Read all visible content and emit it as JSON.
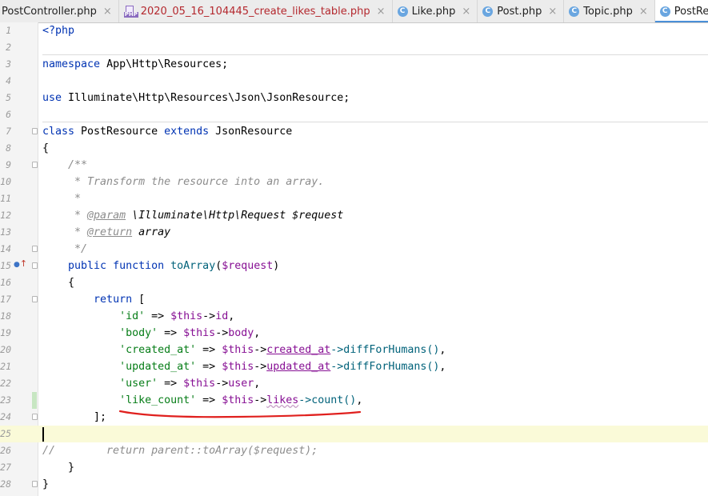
{
  "tabs": [
    {
      "label": "PostController.php",
      "icon": "none",
      "active": false
    },
    {
      "label": "2020_05_16_104445_create_likes_table.php",
      "icon": "php-file-icon",
      "active": false
    },
    {
      "label": "Like.php",
      "icon": "class-icon",
      "active": false
    },
    {
      "label": "Post.php",
      "icon": "class-icon",
      "active": false
    },
    {
      "label": "Topic.php",
      "icon": "class-icon",
      "active": false
    },
    {
      "label": "PostResource.php",
      "icon": "class-icon",
      "active": true
    }
  ],
  "close_glyph": "×",
  "class_icon_letter": "C",
  "php_icon_label": "PHP",
  "line_numbers": [
    "1",
    "2",
    "3",
    "4",
    "5",
    "6",
    "7",
    "8",
    "9",
    "10",
    "11",
    "12",
    "13",
    "14",
    "15",
    "16",
    "17",
    "18",
    "19",
    "20",
    "21",
    "22",
    "23",
    "24",
    "25",
    "26",
    "27",
    "28"
  ],
  "colors": {
    "keyword": "#0033b3",
    "string": "#067d17",
    "variable": "#871094",
    "comment": "#8c8c8c",
    "current_line": "#fafad8",
    "annotation_underline": "#e0201e",
    "active_tab_accent": "#4a8fd8"
  },
  "code": {
    "l1": "<?php",
    "l3_ns_kw": "namespace",
    "l3_ns": " App\\Http\\Resources;",
    "l5_use_kw": "use",
    "l5_use": " Illuminate\\Http\\Resources\\Json\\JsonResource;",
    "l7_class": "class",
    "l7_name": " PostResource ",
    "l7_extends": "extends",
    "l7_parent": " JsonResource",
    "l8": "{",
    "l9": "    /**",
    "l10": "     * Transform the resource into an array.",
    "l11": "     *",
    "l12_a": "     * ",
    "l12_tag": "@param",
    "l12_b": " \\Illuminate\\Http\\Request $request",
    "l13_a": "     * ",
    "l13_tag": "@return",
    "l13_b": " array",
    "l14": "     */",
    "l15_public": "public",
    "l15_function": "function",
    "l15_name": "toArray",
    "l15_param": "$request",
    "l16": "    {",
    "l17_return": "return",
    "l17_rest": " [",
    "rows": [
      {
        "key": "'id'",
        "arrow": " => ",
        "this": "$this",
        "access": "->",
        "prop": "id",
        "tail": ","
      },
      {
        "key": "'body'",
        "arrow": " => ",
        "this": "$this",
        "access": "->",
        "prop": "body",
        "tail": ","
      },
      {
        "key": "'created_at'",
        "arrow": " => ",
        "this": "$this",
        "access": "->",
        "prop": "created_at",
        "call": "->diffForHumans()",
        "tail": ","
      },
      {
        "key": "'updated_at'",
        "arrow": " => ",
        "this": "$this",
        "access": "->",
        "prop": "updated_at",
        "call": "->diffForHumans()",
        "tail": ","
      },
      {
        "key": "'user'",
        "arrow": " => ",
        "this": "$this",
        "access": "->",
        "prop": "user",
        "tail": ","
      },
      {
        "key": "'like_count'",
        "arrow": " => ",
        "this": "$this",
        "access": "->",
        "prop": "likes",
        "call": "->count()",
        "tail": ","
      }
    ],
    "l24": "        ];",
    "l26": "//        return parent::toArray($request);",
    "l27": "    }",
    "l28": "}"
  }
}
